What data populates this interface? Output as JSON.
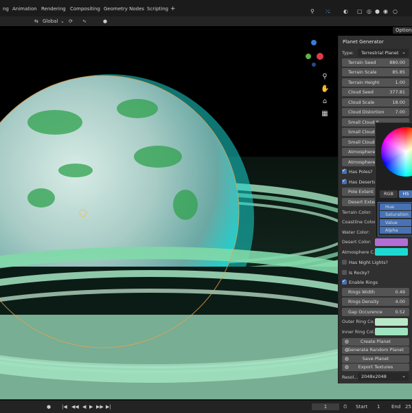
{
  "workspace_tabs": [
    "ng",
    "Animation",
    "Rendering",
    "Compositing",
    "Geometry Nodes",
    "Scripting",
    "+"
  ],
  "toolbar": {
    "orientation": "Global",
    "options_label": "Options"
  },
  "panel": {
    "title": "Planet Generator",
    "type_label": "Type:",
    "type_value": "Terrestrial Planet",
    "fields": [
      {
        "label": "Terrain Seed",
        "value": "880.00"
      },
      {
        "label": "Terrain Scale",
        "value": "85.85"
      },
      {
        "label": "Terrain Height",
        "value": "1.00"
      },
      {
        "label": "Cloud Seed",
        "value": "377.81"
      },
      {
        "label": "Cloud Scale",
        "value": "18.00"
      },
      {
        "label": "Cloud Distortion",
        "value": "7.00"
      },
      {
        "label": "Small Cloud S",
        "value": ""
      },
      {
        "label": "Small Cloud S",
        "value": ""
      },
      {
        "label": "Small Cloud D",
        "value": ""
      },
      {
        "label": "Atmosphere I",
        "value": ""
      },
      {
        "label": "Atmosphere",
        "value": ""
      }
    ],
    "has_poles": "Has Poles?",
    "has_deserts": "Has Deserts",
    "pole_extent": "Pole Extent",
    "desert_extent": "Desert Exten",
    "terrain_color": "Terrain Color:",
    "coastline_color": "Coastline Color:",
    "water_color": "Water Color:",
    "desert_color": "Desert Color:",
    "atmosphere_color": "Atmosphere C...",
    "has_night_lights": "Has Night Lights?",
    "is_rocky": "Is Rocky?",
    "enable_rings": "Enable Rings",
    "rings_width": {
      "label": "Rings Width",
      "value": "0.49"
    },
    "rings_density": {
      "label": "Rings Density",
      "value": "4.00"
    },
    "gap_occurence": {
      "label": "Gap Occurence",
      "value": "0.52"
    },
    "outer_ring_color": "Outer Ring Co...",
    "inner_ring_color": "Inner Ring Col...",
    "buttons": [
      "Create Planet",
      "Generate Random Planet",
      "Save Planet",
      "Export Textures"
    ],
    "resolution_label": "Resol...",
    "resolution_value": "2048x2048",
    "colors": {
      "desert": "#b36fd6",
      "atmosphere": "#1fd9d1",
      "outer_ring": "#b8e8c8",
      "inner_ring": "#9fe3c0"
    }
  },
  "picker": {
    "rgb_tab": "RGB",
    "hsv_tab": "HS",
    "options": [
      "Hue",
      "Saturation",
      "Value",
      "Alpha"
    ]
  },
  "timeline": {
    "frame": "1",
    "start_label": "Start",
    "start_value": "1",
    "end_label": "End",
    "end_value": "25"
  }
}
